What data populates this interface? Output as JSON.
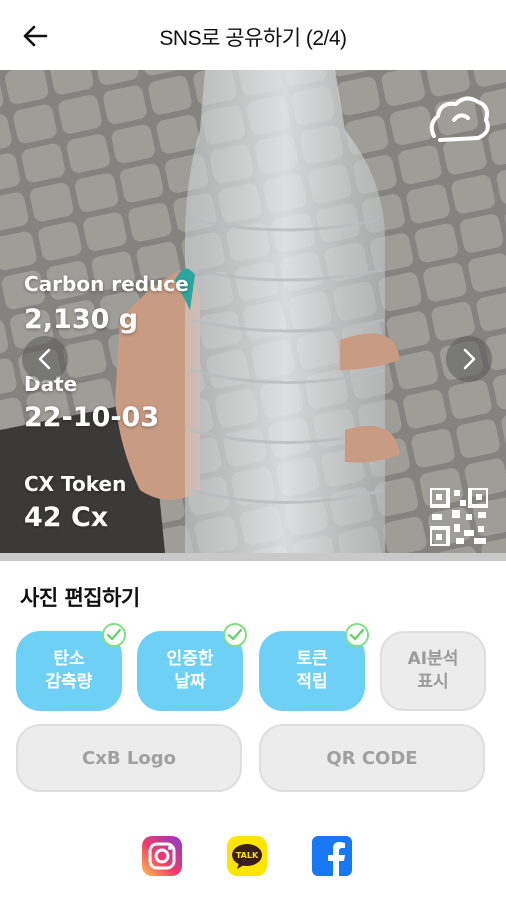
{
  "header": {
    "title": "SNS로 공유하기 (2/4)",
    "back_icon": "arrow-left-icon"
  },
  "photo": {
    "carbon_label": "Carbon reduce",
    "carbon_value": "2,130 g",
    "date_label": "Date",
    "date_value": "22-10-03",
    "token_label": "CX Token",
    "token_value": "42 Cx",
    "prev_icon": "chevron-left-icon",
    "next_icon": "chevron-right-icon"
  },
  "edit": {
    "title": "사진 편집하기",
    "options": [
      {
        "label": "탄소\n감축량",
        "checked": true
      },
      {
        "label": "인증한\n날짜",
        "checked": true
      },
      {
        "label": "토큰\n적립",
        "checked": true
      },
      {
        "label": "AI분석\n표시",
        "checked": false
      }
    ],
    "logo_button": "CxB Logo",
    "qr_button": "QR CODE"
  },
  "share": {
    "icons": [
      "instagram-icon",
      "kakaotalk-icon",
      "facebook-icon"
    ],
    "kakao_text": "TALK"
  },
  "colors": {
    "accent": "#6fd0f5",
    "check": "#7fe07f",
    "disabled": "#ececec",
    "facebook": "#1877f2",
    "kakao": "#fee500"
  }
}
